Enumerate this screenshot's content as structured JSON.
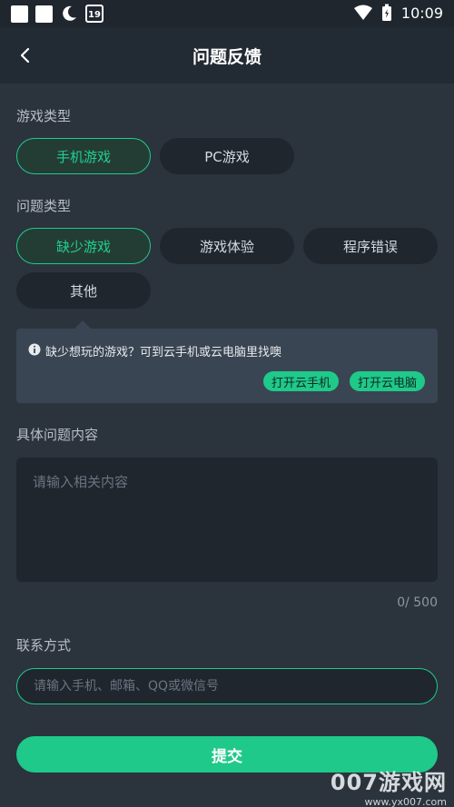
{
  "status_bar": {
    "time": "10:09",
    "calendar_day": "19",
    "icons": [
      "square-icon",
      "square-icon",
      "moon-icon",
      "calendar-icon",
      "wifi-icon",
      "battery-icon"
    ]
  },
  "header": {
    "title": "问题反馈",
    "back_icon": "chevron-left-icon"
  },
  "game_type": {
    "label": "游戏类型",
    "options": [
      {
        "label": "手机游戏",
        "selected": true
      },
      {
        "label": "PC游戏",
        "selected": false
      }
    ]
  },
  "issue_type": {
    "label": "问题类型",
    "options": [
      {
        "label": "缺少游戏",
        "selected": true
      },
      {
        "label": "游戏体验",
        "selected": false
      },
      {
        "label": "程序错误",
        "selected": false
      },
      {
        "label": "其他",
        "selected": false
      }
    ]
  },
  "tip": {
    "text": "缺少想玩的游戏？可到云手机或云电脑里找噢",
    "cloud_phone_label": "打开云手机",
    "cloud_pc_label": "打开云电脑"
  },
  "content": {
    "label": "具体问题内容",
    "placeholder": "请输入相关内容",
    "counter": "0/ 500"
  },
  "contact": {
    "label": "联系方式",
    "placeholder": "请输入手机、邮箱、QQ或微信号"
  },
  "submit_label": "提交",
  "watermark": {
    "main": "007游戏网",
    "sub": "www.yx007.com"
  },
  "colors": {
    "accent": "#1fc98a",
    "background": "#2b333d",
    "header": "#222a33",
    "chip": "#1f262e",
    "tip_bg": "#3a4553"
  }
}
